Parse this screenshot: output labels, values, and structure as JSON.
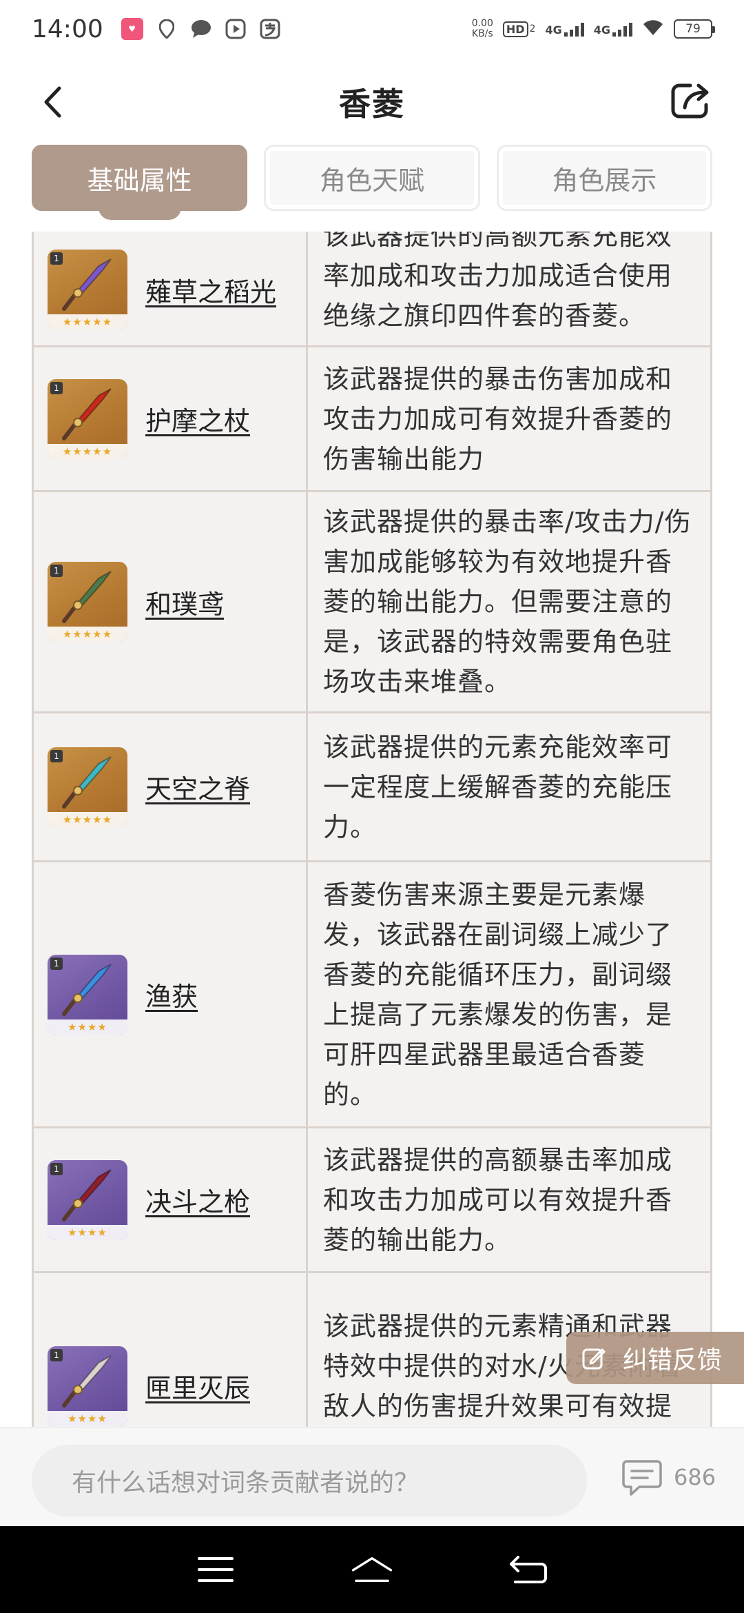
{
  "status_bar": {
    "time": "14:00",
    "speed_top": "0.00",
    "speed_bottom": "KB/s",
    "hd": "HD",
    "hd_sub": "2",
    "net1": "4G",
    "net2": "4G",
    "battery": "79"
  },
  "header": {
    "title": "香菱"
  },
  "tabs": [
    {
      "label": "基础属性",
      "active": true
    },
    {
      "label": "角色天赋",
      "active": false
    },
    {
      "label": "角色展示",
      "active": false
    }
  ],
  "weapons": [
    {
      "name": "薙草之稻光",
      "desc": "该武器提供的高额元素充能效率加成和攻击力加成适合使用绝缘之旗印四件套的香菱。",
      "rarity": "★★★★★",
      "bg": "gold",
      "level": "1",
      "blade_color": "#7b57c9"
    },
    {
      "name": "护摩之杖",
      "desc": "该武器提供的暴击伤害加成和攻击力加成可有效提升香菱的伤害输出能力",
      "rarity": "★★★★★",
      "bg": "gold",
      "level": "1",
      "blade_color": "#c8281e"
    },
    {
      "name": "和璞鸢",
      "desc": "该武器提供的暴击率/攻击力/伤害加成能够较为有效地提升香菱的输出能力。但需要注意的是，该武器的特效需要角色驻场攻击来堆叠。",
      "rarity": "★★★★★",
      "bg": "gold",
      "level": "1",
      "blade_color": "#4d7a4a"
    },
    {
      "name": "天空之脊",
      "desc": "该武器提供的元素充能效率可一定程度上缓解香菱的充能压力。",
      "rarity": "★★★★★",
      "bg": "gold",
      "level": "1",
      "blade_color": "#3fb7c4"
    },
    {
      "name": "渔获",
      "desc": "香菱伤害来源主要是元素爆发，该武器在副词缀上减少了香菱的充能循环压力，副词缀上提高了元素爆发的伤害，是可肝四星武器里最适合香菱的。",
      "rarity": "★★★★",
      "bg": "purple",
      "level": "1",
      "blade_color": "#3b8ee0"
    },
    {
      "name": "决斗之枪",
      "desc": "该武器提供的高额暴击率加成和攻击力加成可以有效提升香菱的输出能力。",
      "rarity": "★★★★",
      "bg": "purple",
      "level": "1",
      "blade_color": "#8f1f2a"
    },
    {
      "name": "匣里灭辰",
      "desc": "该武器提供的元素精通和武器特效中提供的对水/火元素附着敌人的伤害提升效果可有效提升香菱的伤害输出能力",
      "rarity": "★★★★",
      "bg": "purple",
      "level": "1",
      "blade_color": "#d9d3cc"
    }
  ],
  "feedback": {
    "label": "纠错反馈",
    "icon": "edit-icon"
  },
  "comment_bar": {
    "placeholder": "有什么话想对词条贡献者说的？",
    "count": "686"
  },
  "colors": {
    "accent": "#b09a8c",
    "table_border": "#dbd2cc",
    "table_bg": "#f4f2f1"
  }
}
